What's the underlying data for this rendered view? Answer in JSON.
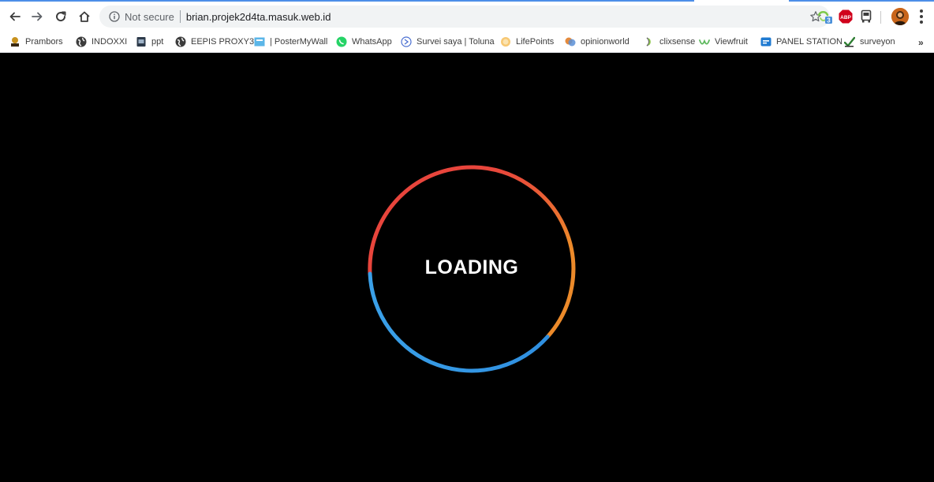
{
  "browser": {
    "security_label": "Not secure",
    "url": "brian.projek2d4ta.masuk.web.id",
    "extension_badge": "3",
    "abp_label": "ABP",
    "overflow_label": "»"
  },
  "bookmarks": [
    {
      "label": "Prambors",
      "icon": "prambors-icon"
    },
    {
      "label": "INDOXXI",
      "icon": "globe-icon"
    },
    {
      "label": "ppt",
      "icon": "slides-icon"
    },
    {
      "label": "EEPIS PROXY3",
      "icon": "globe-icon"
    },
    {
      "label": "| PosterMyWall",
      "icon": "postermywall-icon"
    },
    {
      "label": "WhatsApp",
      "icon": "whatsapp-icon"
    },
    {
      "label": "Survei saya | Toluna",
      "icon": "toluna-icon"
    },
    {
      "label": "LifePoints",
      "icon": "lifepoints-icon"
    },
    {
      "label": "opinionworld",
      "icon": "opinionworld-icon"
    },
    {
      "label": "clixsense",
      "icon": "clixsense-icon"
    },
    {
      "label": "Viewfruit",
      "icon": "viewfruit-icon"
    },
    {
      "label": "PANEL STATION",
      "icon": "panelstation-icon"
    },
    {
      "label": "surveyon",
      "icon": "surveyon-icon"
    }
  ],
  "page": {
    "loading_text": "LOADING",
    "background_color": "#000000",
    "ring_colors": {
      "red": "#e8453c",
      "orange": "#ec8a2a",
      "blue": "#3498db"
    }
  }
}
